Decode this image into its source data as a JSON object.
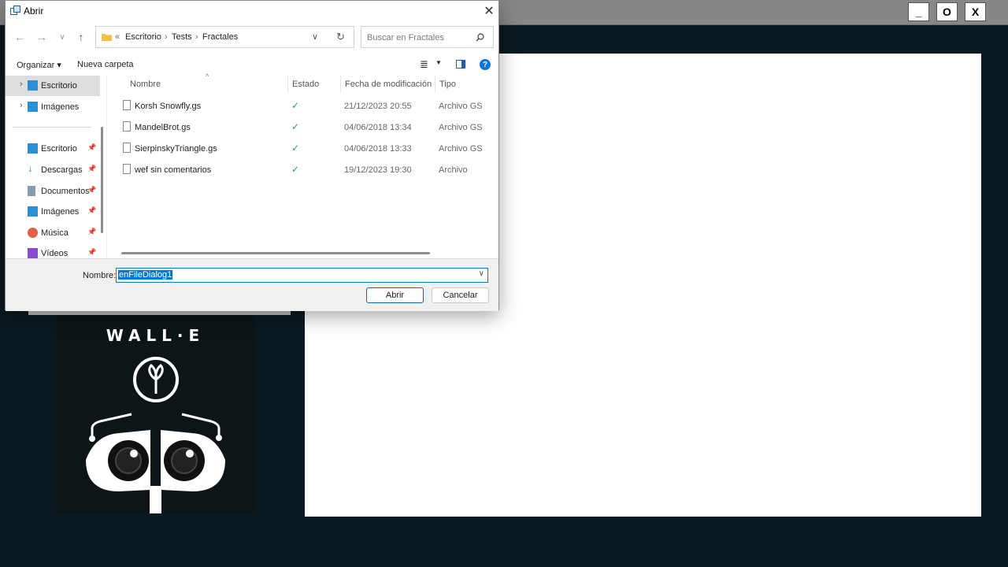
{
  "app": {
    "controls": {
      "minimize": "_",
      "maximize": "O",
      "close": "X"
    },
    "image_logo": "WALL·E"
  },
  "dialog": {
    "title": "Abrir",
    "close_glyph": "✕",
    "breadcrumb": {
      "prefix": "«",
      "parts": [
        "Escritorio",
        "Tests",
        "Fractales"
      ],
      "sep": "›"
    },
    "search_placeholder": "Buscar en Fractales",
    "toolbar": {
      "organize": "Organizar ▾",
      "new_folder": "Nueva carpeta"
    },
    "nav": {
      "tree": [
        {
          "label": "Escritorio",
          "selected": true
        },
        {
          "label": "Imágenes",
          "selected": false
        }
      ],
      "quick_access": [
        {
          "label": "Escritorio",
          "icon": "desktop-icon",
          "color": "#2b8fd6"
        },
        {
          "label": "Descargas",
          "icon": "download-icon",
          "color": "#2b8fd6"
        },
        {
          "label": "Documentos",
          "icon": "document-icon",
          "color": "#8a9bb0"
        },
        {
          "label": "Imágenes",
          "icon": "picture-icon",
          "color": "#2b8fd6"
        },
        {
          "label": "Música",
          "icon": "music-icon",
          "color": "#e0604a"
        },
        {
          "label": "Vídeos",
          "icon": "video-icon",
          "color": "#8a4ad0"
        }
      ]
    },
    "columns": [
      "Nombre",
      "Estado",
      "Fecha de modificación",
      "Tipo"
    ],
    "files": [
      {
        "name": "Korsh Snowfly.gs",
        "status": "✓",
        "modified": "21/12/2023 20:55",
        "type": "Archivo GS"
      },
      {
        "name": "MandelBrot.gs",
        "status": "✓",
        "modified": "04/06/2018 13:34",
        "type": "Archivo GS"
      },
      {
        "name": "SierpinskyTriangle.gs",
        "status": "✓",
        "modified": "04/06/2018 13:33",
        "type": "Archivo GS"
      },
      {
        "name": "wef sin comentarios",
        "status": "✓",
        "modified": "19/12/2023 19:30",
        "type": "Archivo"
      }
    ],
    "filename_label": "Nombre:",
    "filename_value": "enFileDialog1",
    "open_button": "Abrir",
    "cancel_button": "Cancelar"
  }
}
